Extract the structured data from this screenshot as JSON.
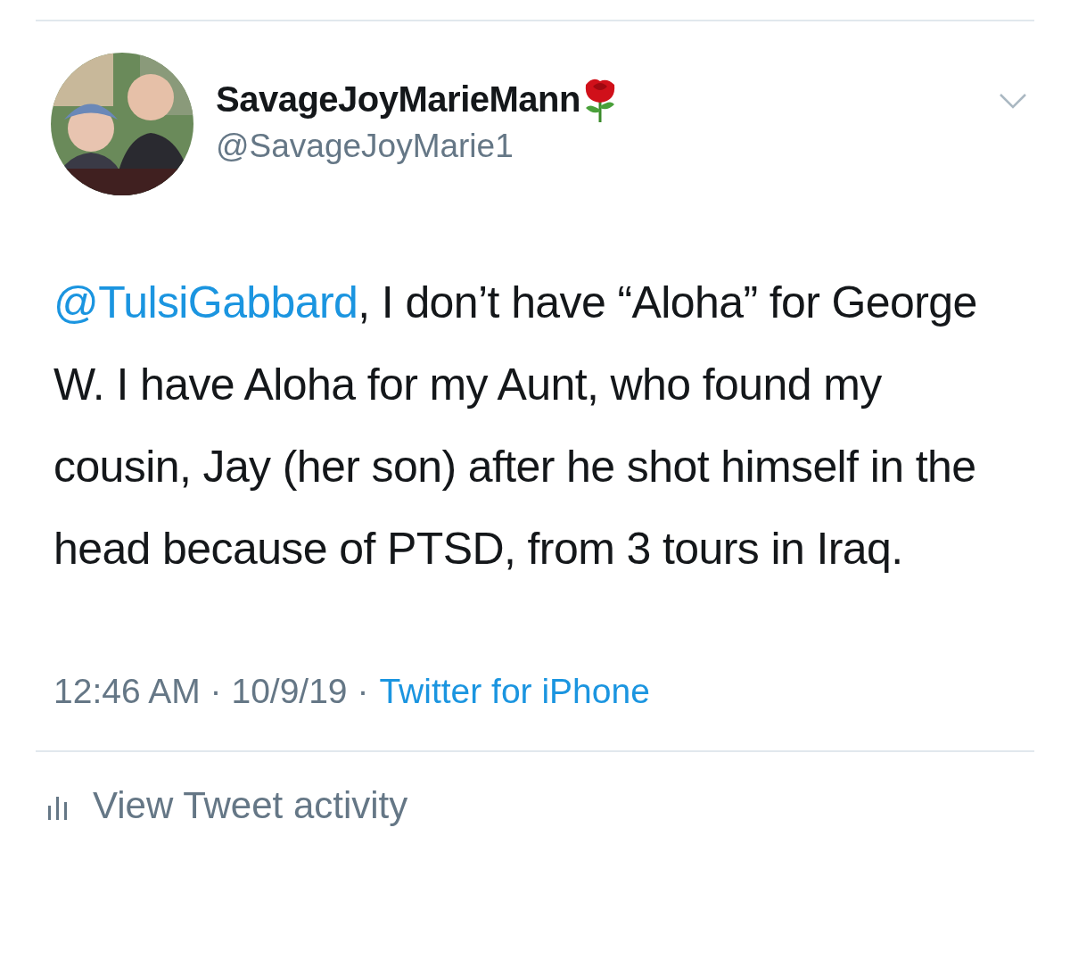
{
  "tweet": {
    "author_name": "SavageJoyMarieMann",
    "handle": "@SavageJoyMarie1",
    "mention": "@TulsiGabbard",
    "text": ", I don’t have “Aloha” for George W. I have Aloha for my Aunt, who found my cousin, Jay (her son) after he shot himself in the head because of PTSD, from 3 tours in Iraq.",
    "timestamp": "12:46 AM · 10/9/19 ·",
    "source": "Twitter for iPhone",
    "activity": "View Tweet activity"
  }
}
